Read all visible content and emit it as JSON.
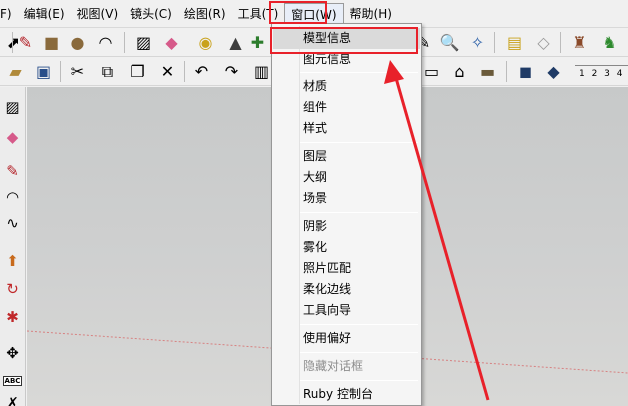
{
  "menubar": {
    "items": [
      "F)",
      "编辑(E)",
      "视图(V)",
      "镜头(C)",
      "绘图(R)",
      "工具(T)",
      "窗口(W)",
      "帮助(H)"
    ]
  },
  "dropdown": {
    "model_info": "模型信息",
    "entity_info": "图元信息",
    "materials": "材质",
    "components": "组件",
    "styles": "样式",
    "layers": "图层",
    "outliner": "大纲",
    "scenes": "场景",
    "shadows": "阴影",
    "fog": "雾化",
    "match_photo": "照片匹配",
    "soften_edges": "柔化边线",
    "instructor": "工具向导",
    "preferences": "使用偏好",
    "hide_dialogs": "隐藏对话框",
    "ruby_console": "Ruby 控制台"
  },
  "toolbar": {
    "scale_labels": "1 2 3 4"
  },
  "left_toolbar": {
    "text_tool_label": "ABC"
  },
  "colors": {
    "annotation": "#e8212a",
    "menu_highlight": "#dadada"
  }
}
